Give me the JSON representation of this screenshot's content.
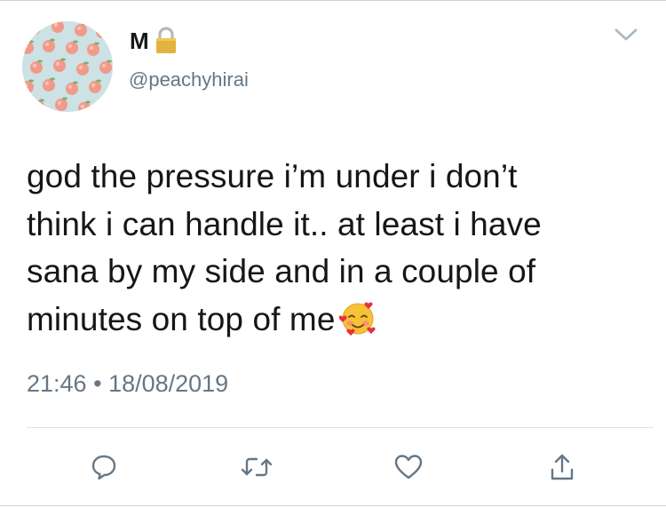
{
  "user": {
    "display_name": "M",
    "handle": "@peachyhirai",
    "avatar_icon": "peach-pattern-avatar",
    "verified_lock_icon": "lock-icon"
  },
  "tweet": {
    "lines": [
      "god the pressure i’m under i don’t",
      "think i can handle it.. at least i have",
      "sana by my side and in a couple of",
      "minutes on top of me"
    ],
    "emoji": "smiling-face-with-hearts-emoji",
    "time": "21:46",
    "separator": "•",
    "date": "18/08/2019"
  },
  "actions": {
    "reply": "reply-icon",
    "retweet": "retweet-icon",
    "like": "heart-icon",
    "share": "share-icon",
    "menu": "chevron-down-icon"
  },
  "colors": {
    "text": "#14171a",
    "secondary": "#657786",
    "icon": "#657786",
    "avatar_bg": "#cfe3e6",
    "peach": "#f2a08f"
  }
}
